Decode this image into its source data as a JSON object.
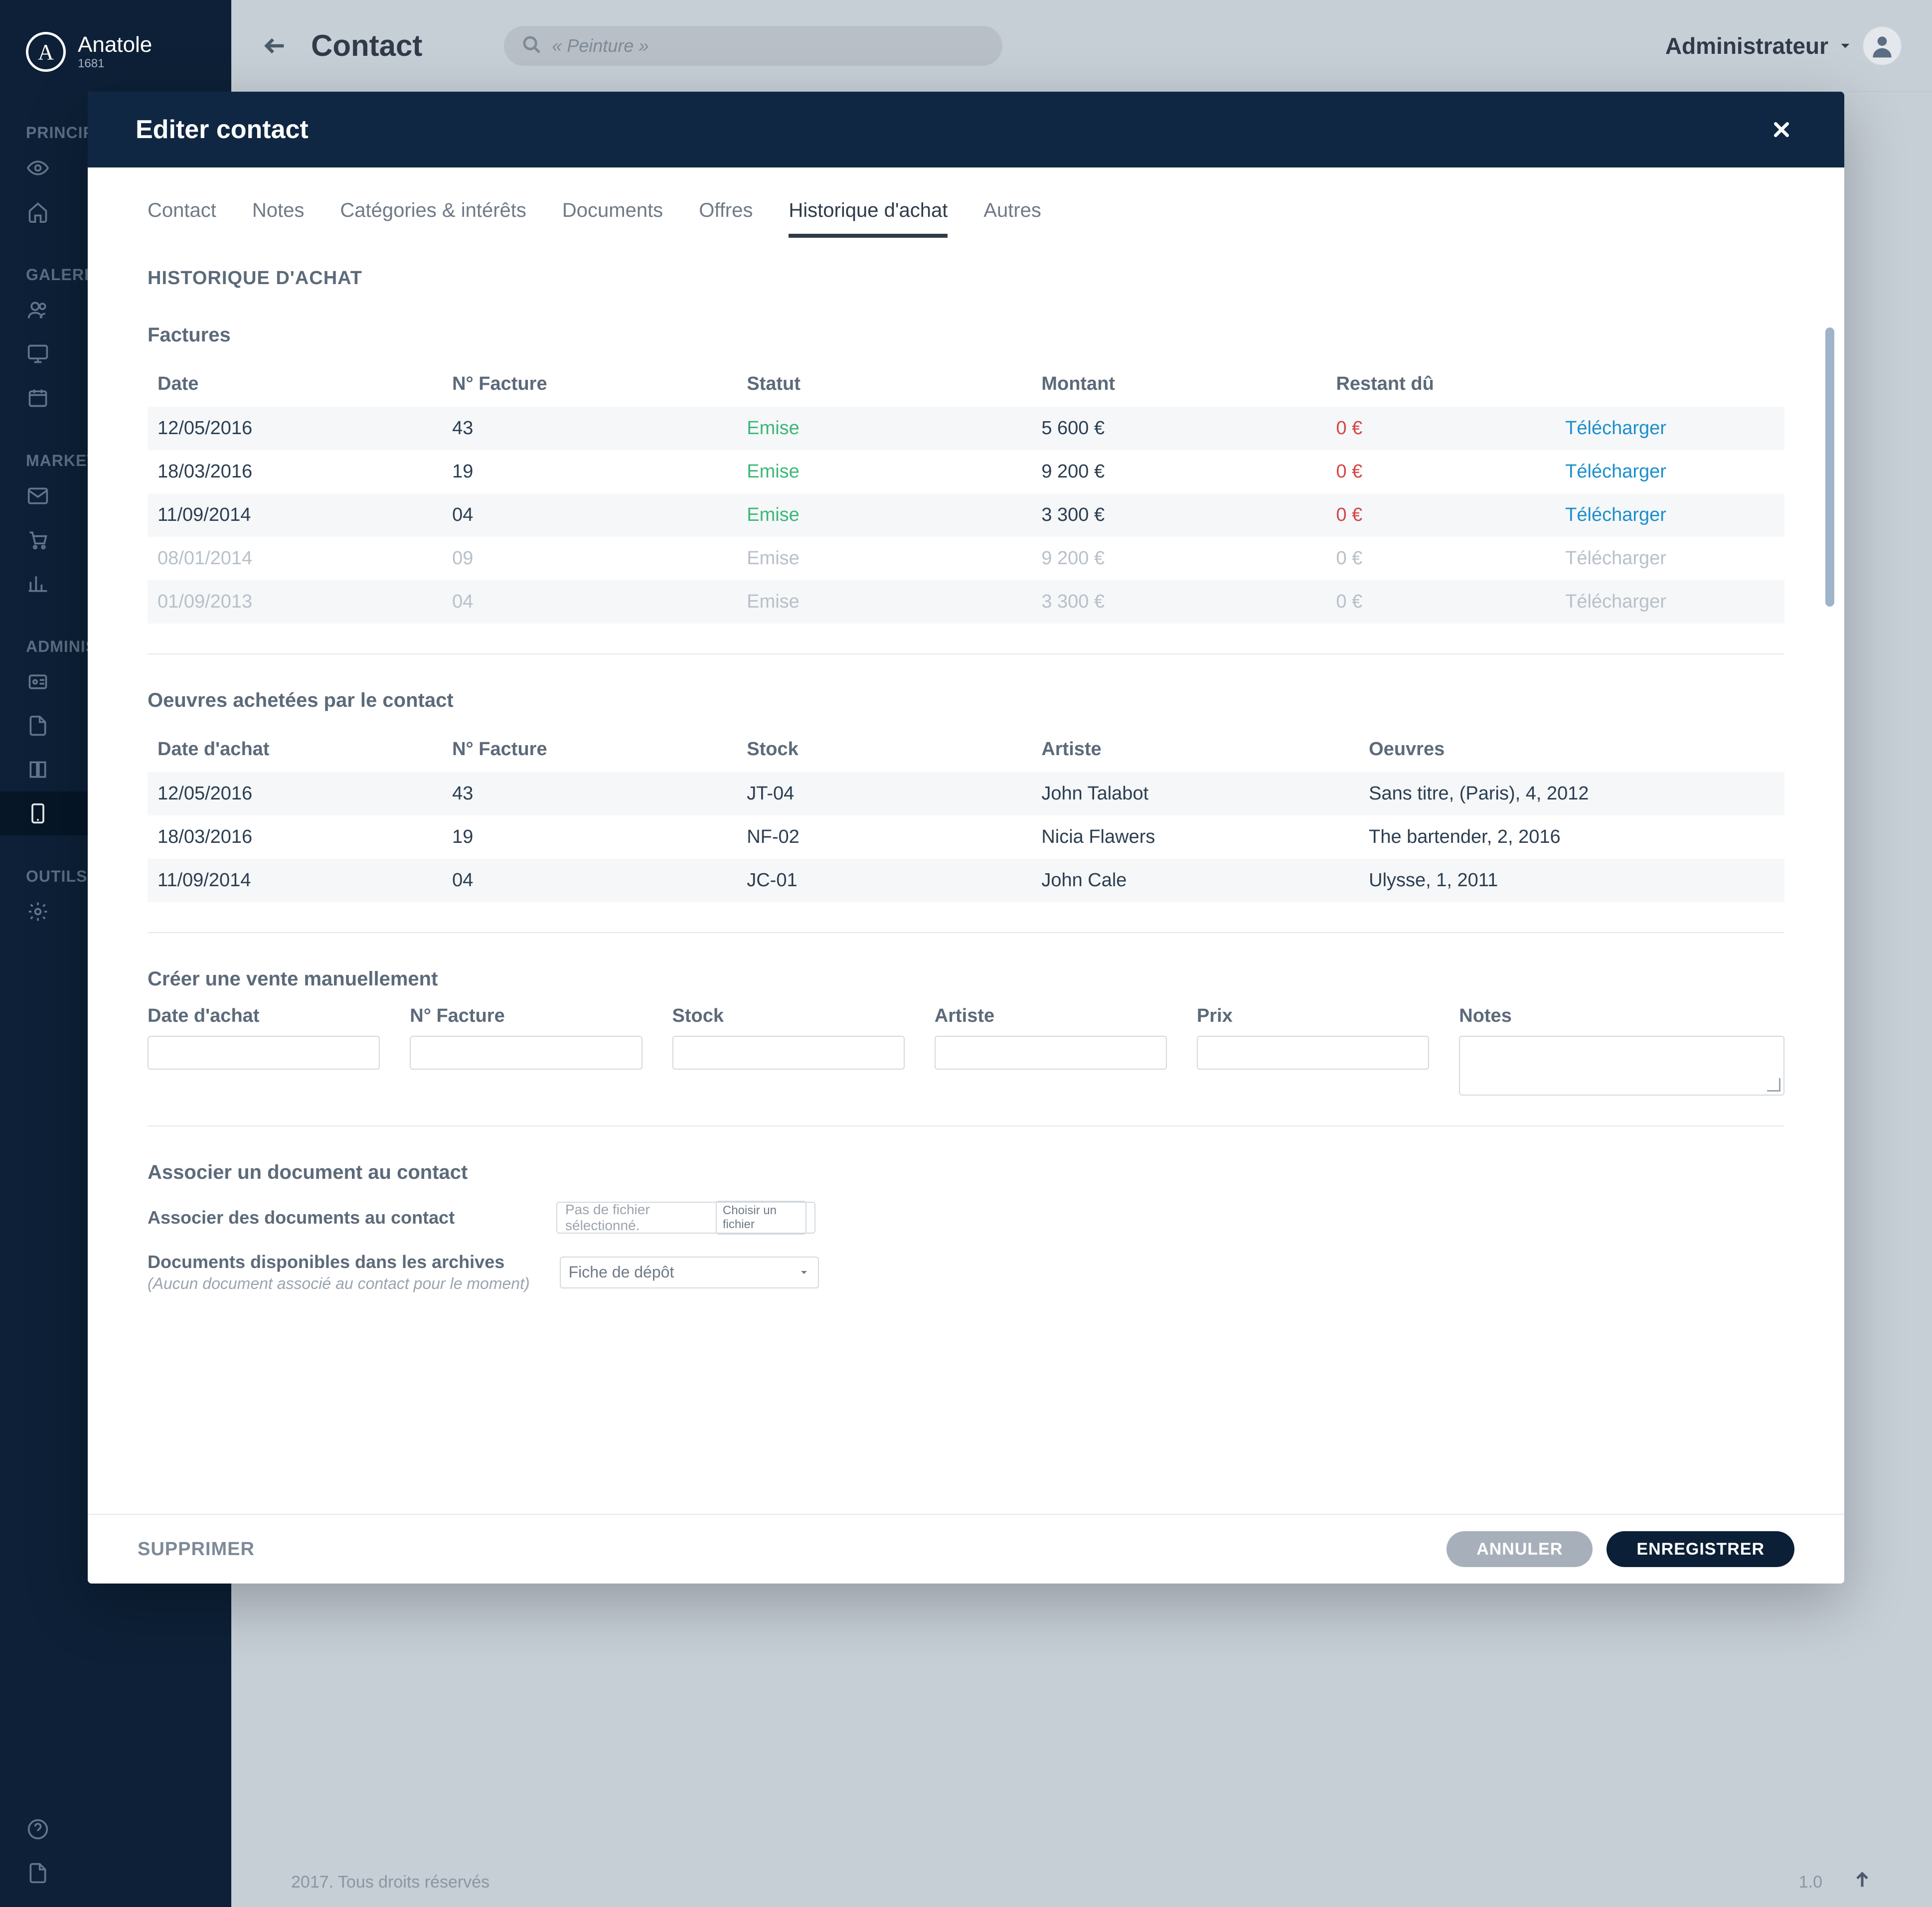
{
  "brand": {
    "name": "Anatole",
    "year": "1681",
    "initial": "A"
  },
  "top": {
    "page_title": "Contact",
    "search_placeholder": "« Peinture »",
    "user_label": "Administrateur"
  },
  "footer": {
    "copyright": "2017. Tous droits réservés",
    "version": "1.0"
  },
  "sidebar": {
    "groups": [
      {
        "title": "PRINCIPAL"
      },
      {
        "title": "GALERIE"
      },
      {
        "title": "MARKETING"
      },
      {
        "title": "ADMINISTRATION"
      },
      {
        "title": "OUTILS"
      }
    ]
  },
  "modal": {
    "title": "Editer contact",
    "tabs": [
      "Contact",
      "Notes",
      "Catégories & intérêts",
      "Documents",
      "Offres",
      "Historique d'achat",
      "Autres"
    ],
    "active_tab_index": 5,
    "actions": {
      "delete": "SUPPRIMER",
      "cancel": "ANNULER",
      "save": "ENREGISTRER"
    },
    "history": {
      "heading": "HISTORIQUE D'ACHAT",
      "invoices": {
        "title": "Factures",
        "columns": [
          "Date",
          "N° Facture",
          "Statut",
          "Montant",
          "Restant dû",
          ""
        ],
        "download_label": "Télécharger",
        "rows": [
          {
            "date": "12/05/2016",
            "num": "43",
            "status": "Emise",
            "amount": "5 600 €",
            "due": "0 €",
            "disabled": false
          },
          {
            "date": "18/03/2016",
            "num": "19",
            "status": "Emise",
            "amount": "9 200 €",
            "due": "0 €",
            "disabled": false
          },
          {
            "date": "11/09/2014",
            "num": "04",
            "status": "Emise",
            "amount": "3 300 €",
            "due": "0 €",
            "disabled": false
          },
          {
            "date": "08/01/2014",
            "num": "09",
            "status": "Emise",
            "amount": "9 200 €",
            "due": "0 €",
            "disabled": true
          },
          {
            "date": "01/09/2013",
            "num": "04",
            "status": "Emise",
            "amount": "3 300 €",
            "due": "0 €",
            "disabled": true
          }
        ]
      },
      "works": {
        "title": "Oeuvres achetées par le contact",
        "columns": [
          "Date d'achat",
          "N° Facture",
          "Stock",
          "Artiste",
          "Oeuvres"
        ],
        "rows": [
          {
            "date": "12/05/2016",
            "num": "43",
            "stock": "JT-04",
            "artist": "John Talabot",
            "work": "Sans titre, (Paris), 4, 2012"
          },
          {
            "date": "18/03/2016",
            "num": "19",
            "stock": "NF-02",
            "artist": "Nicia Flawers",
            "work": "The bartender, 2, 2016"
          },
          {
            "date": "11/09/2014",
            "num": "04",
            "stock": "JC-01",
            "artist": "John Cale",
            "work": "Ulysse, 1, 2011"
          }
        ]
      },
      "manual_sale": {
        "title": "Créer une vente manuellement",
        "fields": {
          "date": "Date d'achat",
          "num": "N° Facture",
          "stock": "Stock",
          "artist": "Artiste",
          "price": "Prix",
          "notes": "Notes"
        }
      },
      "associate": {
        "title": "Associer un document au contact",
        "row1_label": "Associer des documents au contact",
        "file_placeholder": "Pas de fichier sélectionné.",
        "file_button": "Choisir un fichier",
        "row2_label": "Documents disponibles dans les archives",
        "row2_note": "(Aucun document associé au contact pour le moment)",
        "select_value": "Fiche de dépôt"
      }
    }
  }
}
